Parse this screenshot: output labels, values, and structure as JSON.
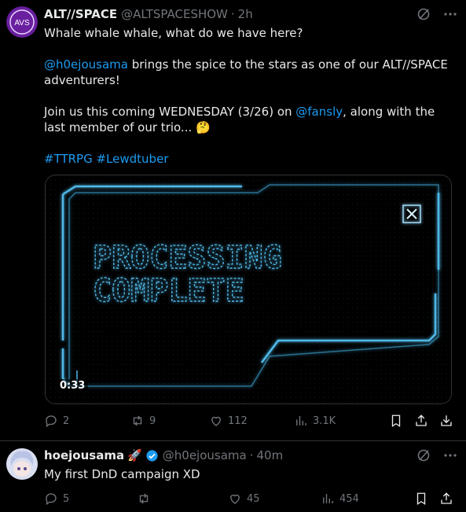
{
  "tweet1": {
    "name": "ALT//SPACE",
    "handle": "@ALTSPACESHOW",
    "time": "2h",
    "avatar_text": "AVS",
    "line1": "Whale whale whale, what do we have here?",
    "mention1": "@h0ejousama",
    "line2": " brings the spice to the stars as one of our ALT//SPACE adventurers!",
    "line3a": "Join us this coming WEDNESDAY (3/26) on ",
    "mention2": "@fansly",
    "line3b": ", along with the last member of our trio... ",
    "emoji": "🤔",
    "hashtags": "#TTRPG #Lewdtuber",
    "media": {
      "text_line1": "PROCESSING",
      "text_line2": "COMPLETE",
      "duration": "0:33"
    },
    "replies": "2",
    "retweets": "9",
    "likes": "112",
    "views": "3.1K"
  },
  "tweet2": {
    "name": "hoejousama",
    "name_emoji": "🚀",
    "handle": "@h0ejousama",
    "time": "40m",
    "text": "My first DnD campaign XD",
    "replies": "5",
    "retweets": "",
    "likes": "45",
    "views": "454"
  },
  "colors": {
    "accent": "#1d9bf0",
    "muted": "#71767b",
    "glow": "#4fb8e8"
  }
}
